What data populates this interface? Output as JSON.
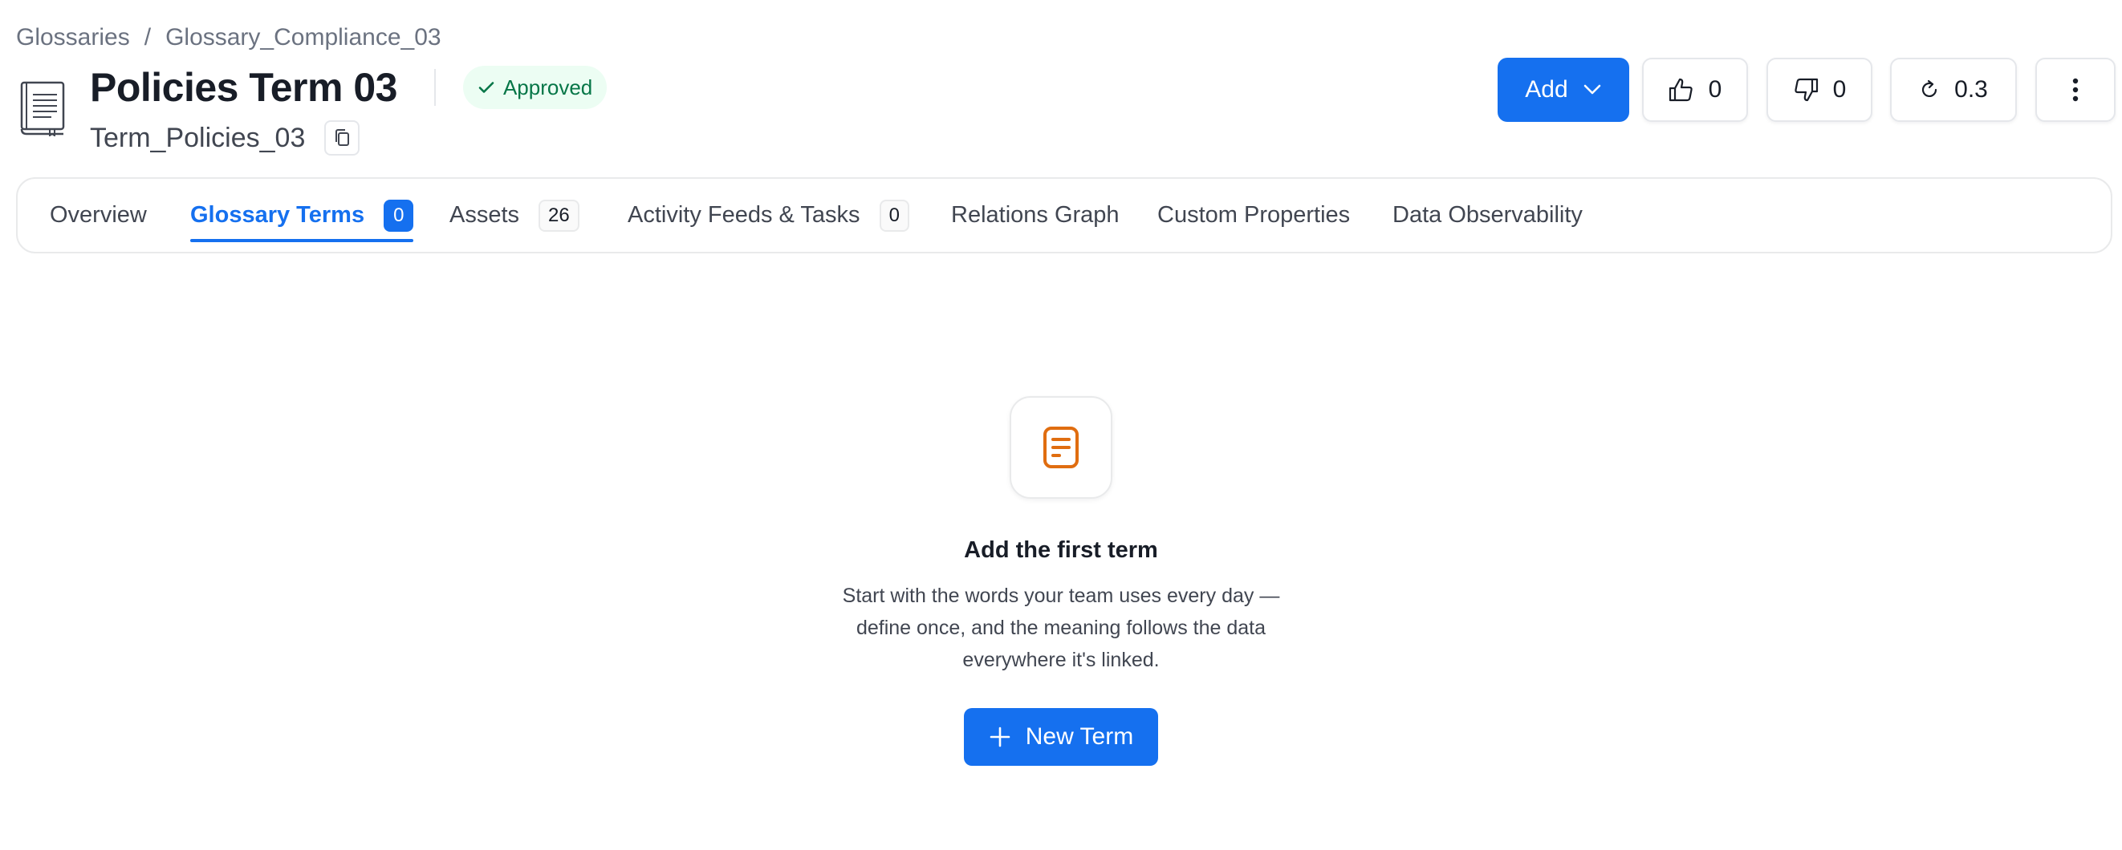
{
  "breadcrumb": {
    "items": [
      "Glossaries",
      "Glossary_Compliance_03"
    ],
    "separator": "/"
  },
  "term": {
    "title": "Policies Term 03",
    "name": "Term_Policies_03",
    "status": "Approved",
    "icon": "book-icon"
  },
  "actions": {
    "add_label": "Add",
    "likes": "0",
    "dislikes": "0",
    "version": "0.3"
  },
  "tabs": [
    {
      "label": "Overview",
      "count": null,
      "active": false
    },
    {
      "label": "Glossary Terms",
      "count": "0",
      "active": true
    },
    {
      "label": "Assets",
      "count": "26",
      "active": false
    },
    {
      "label": "Activity Feeds & Tasks",
      "count": "0",
      "active": false
    },
    {
      "label": "Relations Graph",
      "count": null,
      "active": false
    },
    {
      "label": "Custom Properties",
      "count": null,
      "active": false
    },
    {
      "label": "Data Observability",
      "count": null,
      "active": false
    }
  ],
  "empty_state": {
    "icon": "document-icon",
    "title": "Add the first term",
    "description_lines": [
      "Start with the words your team uses every day —",
      "define once, and the meaning follows the data",
      "everywhere it's linked."
    ],
    "button_label": "New Term"
  },
  "colors": {
    "primary": "#1570ef",
    "status_bg": "#ecfdf3",
    "status_text": "#067647",
    "empty_icon": "#e06d10"
  }
}
